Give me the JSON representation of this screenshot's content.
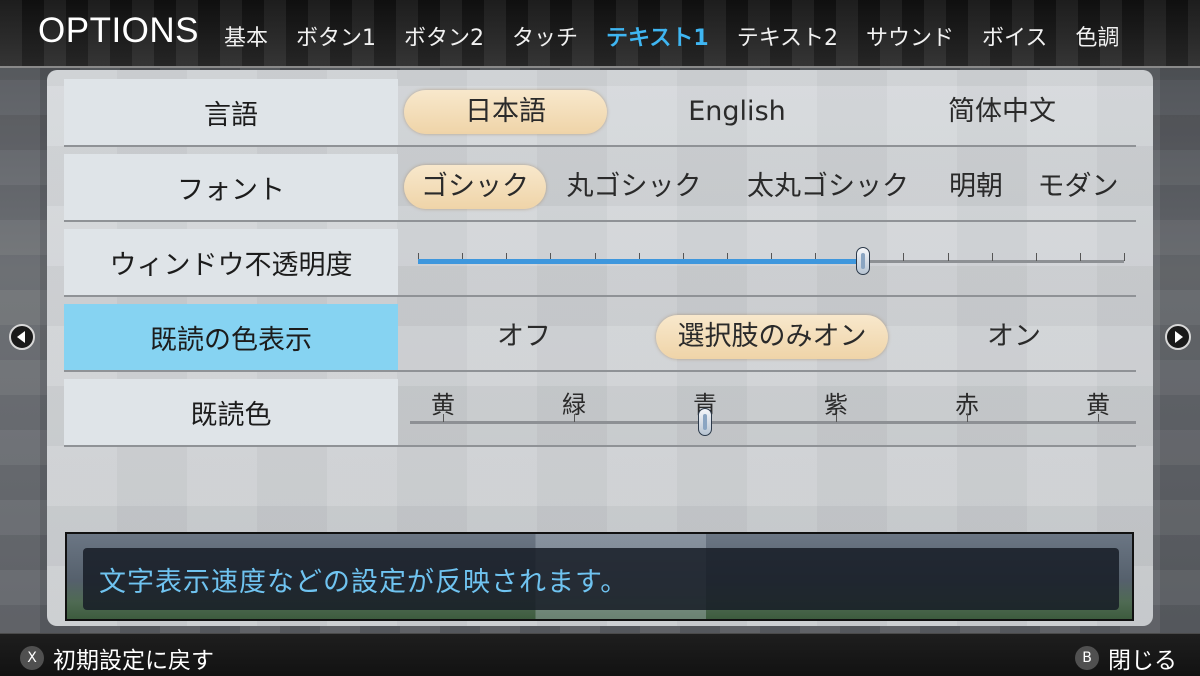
{
  "header": {
    "title": "OPTIONS",
    "tabs": [
      "基本",
      "ボタン1",
      "ボタン2",
      "タッチ",
      "テキスト1",
      "テキスト2",
      "サウンド",
      "ボイス",
      "色調"
    ],
    "active_tab": "テキスト1"
  },
  "rows": {
    "language": {
      "label": "言語",
      "options": [
        "日本語",
        "English",
        "简体中文"
      ],
      "selected": "日本語"
    },
    "font": {
      "label": "フォント",
      "options": [
        "ゴシック",
        "丸ゴシック",
        "太丸ゴシック",
        "明朝",
        "モダン"
      ],
      "selected": "ゴシック"
    },
    "opacity": {
      "label": "ウィンドウ不透明度",
      "value_fraction": 0.63,
      "tick_count": 17
    },
    "read_color_display": {
      "label": "既読の色表示",
      "options": [
        "オフ",
        "選択肢のみオン",
        "オン"
      ],
      "selected": "選択肢のみオン"
    },
    "read_color": {
      "label": "既読色",
      "colors": [
        "黄",
        "緑",
        "青",
        "紫",
        "赤",
        "黄"
      ],
      "selected_index": 2
    }
  },
  "description": "文字表示速度などの設定が反映されます。",
  "footer": {
    "reset_key": "X",
    "reset_label": "初期設定に戻す",
    "close_key": "B",
    "close_label": "閉じる"
  },
  "colors": {
    "active_tab": "#3fb6f2",
    "active_row_label": "#86d3f2",
    "selected_option": "#efd4a8",
    "slider_fill": "#3e97dd",
    "description_text": "#6fc3f0"
  }
}
